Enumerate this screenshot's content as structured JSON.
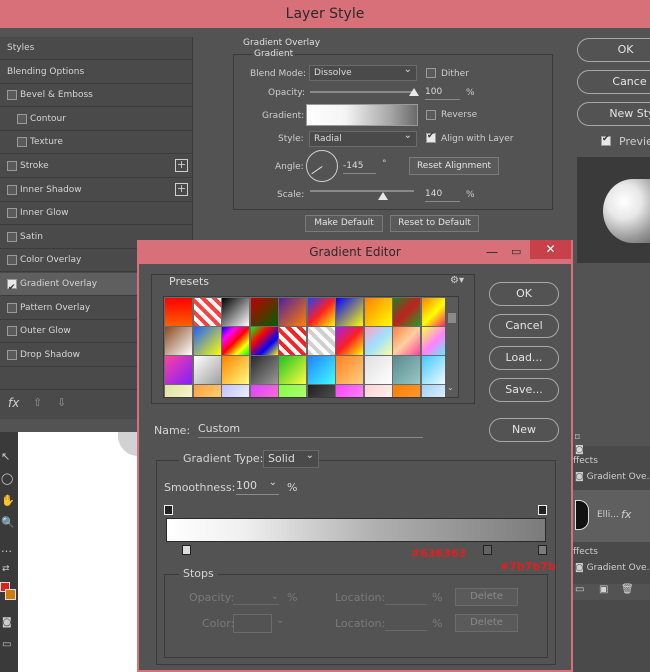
{
  "layer_style": {
    "title": "Layer Style",
    "sidebar": {
      "items": [
        {
          "label": "Styles",
          "checkbox": false,
          "plus": false,
          "checked": false
        },
        {
          "label": "Blending Options",
          "checkbox": false,
          "plus": false,
          "checked": false
        },
        {
          "label": "Bevel & Emboss",
          "checkbox": true,
          "plus": false,
          "checked": false
        },
        {
          "label": "Contour",
          "checkbox": true,
          "plus": false,
          "checked": false,
          "indent": true
        },
        {
          "label": "Texture",
          "checkbox": true,
          "plus": false,
          "checked": false,
          "indent": true
        },
        {
          "label": "Stroke",
          "checkbox": true,
          "plus": true,
          "checked": false
        },
        {
          "label": "Inner Shadow",
          "checkbox": true,
          "plus": true,
          "checked": false
        },
        {
          "label": "Inner Glow",
          "checkbox": true,
          "plus": false,
          "checked": false
        },
        {
          "label": "Satin",
          "checkbox": true,
          "plus": false,
          "checked": false
        },
        {
          "label": "Color Overlay",
          "checkbox": true,
          "plus": true,
          "checked": false
        },
        {
          "label": "Gradient Overlay",
          "checkbox": true,
          "plus": true,
          "checked": true,
          "selected": true
        },
        {
          "label": "Pattern Overlay",
          "checkbox": true,
          "plus": false,
          "checked": false
        },
        {
          "label": "Outer Glow",
          "checkbox": true,
          "plus": false,
          "checked": false
        },
        {
          "label": "Drop Shadow",
          "checkbox": true,
          "plus": true,
          "checked": false
        }
      ],
      "fx": "fx"
    },
    "panel": {
      "section": "Gradient Overlay",
      "subsection": "Gradient",
      "blend_mode_label": "Blend Mode:",
      "blend_mode": "Dissolve",
      "dither": "Dither",
      "opacity_label": "Opacity:",
      "opacity": "100",
      "opacity_level": 1.0,
      "pct": "%",
      "gradient_label": "Gradient:",
      "reverse": "Reverse",
      "style_label": "Style:",
      "style": "Radial",
      "align": "Align with Layer",
      "angle_label": "Angle:",
      "angle": "-145",
      "deg": "°",
      "reset_alignment": "Reset Alignment",
      "scale_label": "Scale:",
      "scale": "140",
      "scale_level": 0.7,
      "make_default": "Make Default",
      "reset_default": "Reset to Default"
    },
    "right": {
      "ok": "OK",
      "cancel": "Cance",
      "new_style": "New Styl",
      "preview": "Previe"
    }
  },
  "layers_panel": {
    "effects1": "ffects",
    "gradient_ov1": "Gradient Ove...",
    "layer_name": "Elli...",
    "fx": "fx",
    "effects2": "ffects",
    "gradient_ov2": "Gradient Ove..."
  },
  "gradient_editor": {
    "title": "Gradient Editor",
    "presets_label": "Presets",
    "ok": "OK",
    "cancel": "Cancel",
    "load": "Load...",
    "save": "Save...",
    "name_label": "Name:",
    "name_value": "Custom",
    "new": "New",
    "gradient_type_label": "Gradient Type:",
    "gradient_type": "Solid",
    "smoothness_label": "Smoothness:",
    "smoothness": "100",
    "pct": "%",
    "stop_color1": "#636363",
    "stop_color2": "#7b7b7b",
    "stops_label": "Stops",
    "opacity_label": "Opacity:",
    "color_label": "Color:",
    "location_label": "Location:",
    "delete": "Delete",
    "accent": "#d8707a"
  }
}
